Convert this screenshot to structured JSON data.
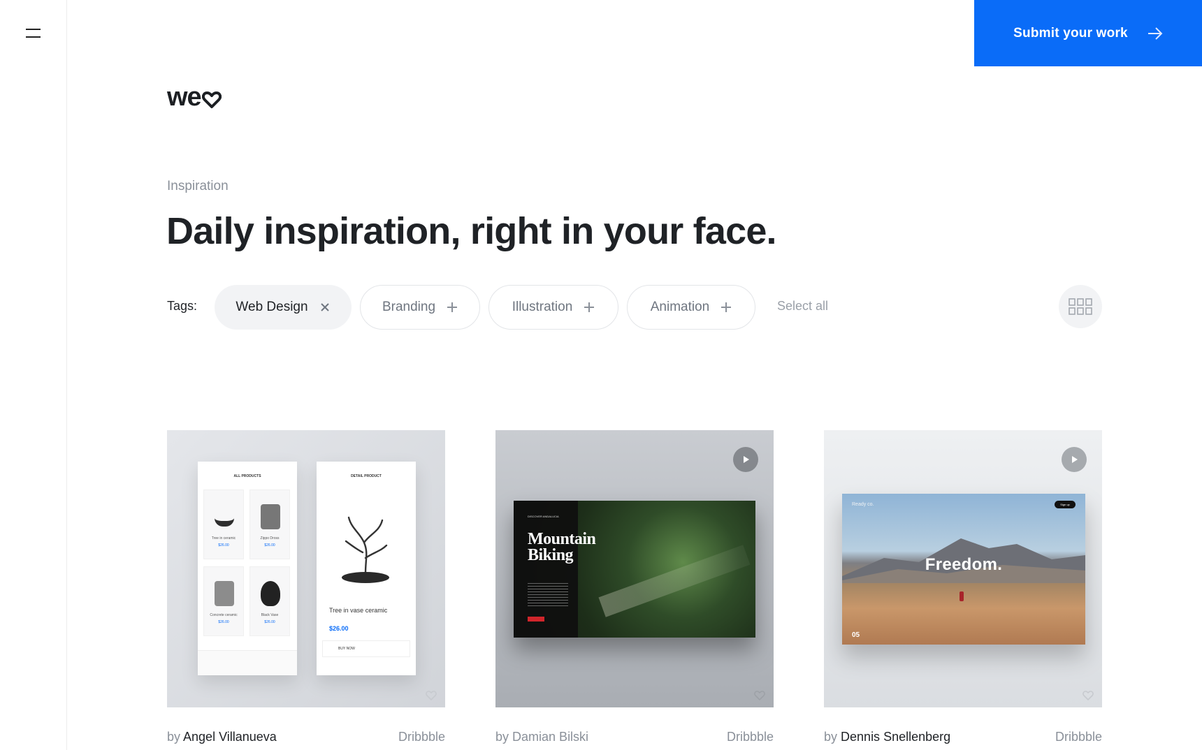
{
  "header": {
    "menu_icon": "hamburger-menu-icon",
    "logo_text": "we",
    "logo_icon": "heart-icon",
    "submit_label": "Submit your work",
    "submit_icon": "arrow-right-icon",
    "accent_color": "#0a6cf8"
  },
  "hero": {
    "eyebrow": "Inspiration",
    "headline": "Daily inspiration, right in your face."
  },
  "tags": {
    "label": "Tags:",
    "items": [
      {
        "label": "Web Design",
        "active": true,
        "icon": "close-icon"
      },
      {
        "label": "Branding",
        "active": false,
        "icon": "plus-icon"
      },
      {
        "label": "Illustration",
        "active": false,
        "icon": "plus-icon"
      },
      {
        "label": "Animation",
        "active": false,
        "icon": "plus-icon"
      }
    ],
    "select_all": "Select all",
    "view_toggle_icon": "grid-view-icon"
  },
  "cards": [
    {
      "by": "by",
      "author": "Angel Villanueva",
      "source": "Dribbble",
      "video": false,
      "mock": {
        "list_header": "ALL PRODUCTS",
        "detail_header": "DETAIL PRODUCT",
        "products": [
          {
            "name": "Tree in ceramic",
            "price": "$26.00"
          },
          {
            "name": "Zippo Dross",
            "price": "$26.00"
          },
          {
            "name": "Concrete ceramic",
            "price": "$26.00"
          },
          {
            "name": "Black Vase",
            "price": "$26.00"
          }
        ],
        "detail_name": "Tree in vase ceramic",
        "detail_price": "$26.00",
        "buy_label": "BUY NOW"
      }
    },
    {
      "by": "by",
      "author": "Damian Bilski",
      "source": "Dribbble",
      "video": true,
      "mock": {
        "kicker": "DISCOVER ANDALUCIA",
        "title_line1": "Mountain",
        "title_line2": "Biking"
      }
    },
    {
      "by": "by",
      "author": "Dennis Snellenberg",
      "source": "Dribbble",
      "video": true,
      "mock": {
        "brand": "Ready co.",
        "signup": "Sign up",
        "headline": "Freedom.",
        "slide": "05"
      }
    }
  ]
}
